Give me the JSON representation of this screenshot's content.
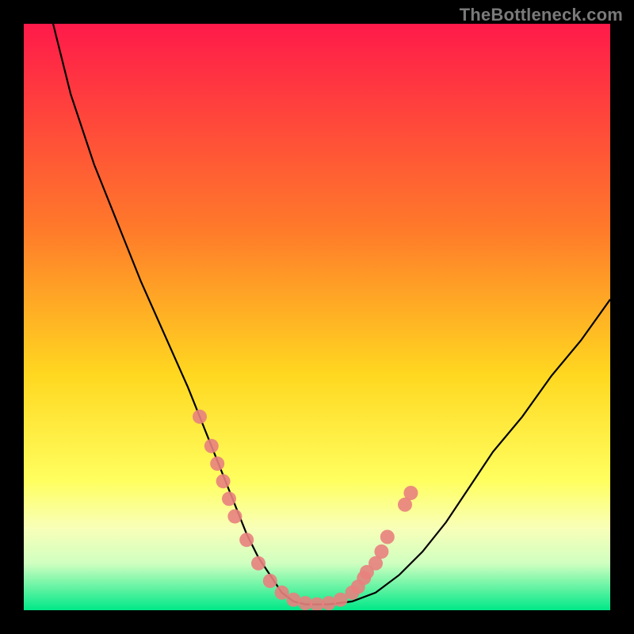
{
  "watermark": "TheBottleneck.com",
  "chart_data": {
    "type": "line",
    "title": "",
    "xlabel": "",
    "ylabel": "",
    "xlim": [
      0,
      100
    ],
    "ylim": [
      0,
      100
    ],
    "gradient_stops": [
      {
        "offset": 0,
        "color": "#ff1a4a"
      },
      {
        "offset": 35,
        "color": "#ff7a2a"
      },
      {
        "offset": 60,
        "color": "#ffd820"
      },
      {
        "offset": 78,
        "color": "#ffff60"
      },
      {
        "offset": 86,
        "color": "#f8ffb8"
      },
      {
        "offset": 92,
        "color": "#d0ffc0"
      },
      {
        "offset": 100,
        "color": "#00e888"
      }
    ],
    "series": [
      {
        "name": "bottleneck-curve",
        "x": [
          5,
          8,
          12,
          16,
          20,
          24,
          28,
          30,
          32,
          34,
          36,
          38,
          40,
          42,
          44,
          46,
          48,
          52,
          56,
          60,
          64,
          68,
          72,
          76,
          80,
          85,
          90,
          95,
          100
        ],
        "y": [
          100,
          88,
          76,
          66,
          56,
          47,
          38,
          33,
          28,
          23,
          18,
          13,
          9,
          6,
          3,
          1.5,
          1,
          1,
          1.5,
          3,
          6,
          10,
          15,
          21,
          27,
          33,
          40,
          46,
          53
        ]
      }
    ],
    "markers": [
      {
        "x": 30,
        "y": 33
      },
      {
        "x": 32,
        "y": 28
      },
      {
        "x": 33,
        "y": 25
      },
      {
        "x": 34,
        "y": 22
      },
      {
        "x": 35,
        "y": 19
      },
      {
        "x": 36,
        "y": 16
      },
      {
        "x": 38,
        "y": 12
      },
      {
        "x": 40,
        "y": 8
      },
      {
        "x": 42,
        "y": 5
      },
      {
        "x": 44,
        "y": 3
      },
      {
        "x": 46,
        "y": 1.8
      },
      {
        "x": 48,
        "y": 1.2
      },
      {
        "x": 50,
        "y": 1
      },
      {
        "x": 52,
        "y": 1.2
      },
      {
        "x": 54,
        "y": 1.8
      },
      {
        "x": 56,
        "y": 3
      },
      {
        "x": 57,
        "y": 4
      },
      {
        "x": 58,
        "y": 5.5
      },
      {
        "x": 60,
        "y": 8
      },
      {
        "x": 61,
        "y": 10
      },
      {
        "x": 62,
        "y": 12.5
      },
      {
        "x": 65,
        "y": 18
      },
      {
        "x": 66,
        "y": 20
      },
      {
        "x": 58.5,
        "y": 6.5
      }
    ],
    "marker_style": {
      "radius": 9,
      "fill": "#e8817e",
      "opacity": 0.9
    }
  }
}
